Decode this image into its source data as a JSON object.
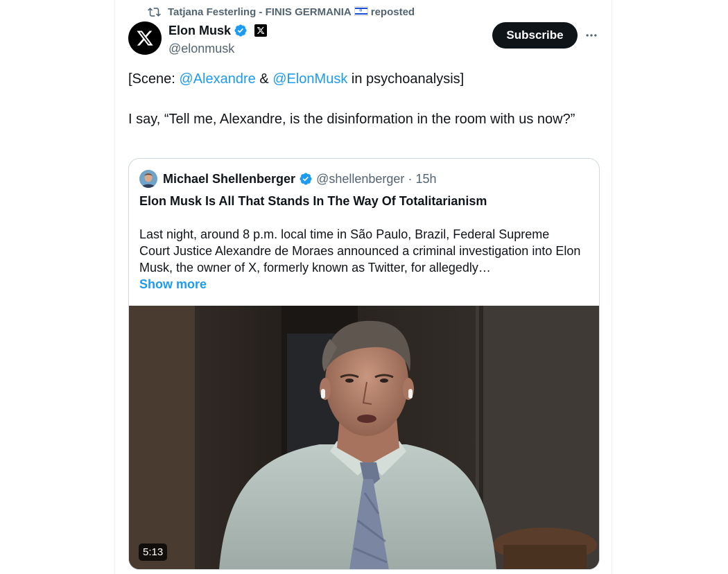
{
  "repost": {
    "name": "Tatjana Festerling - FINIS GERMANIA",
    "suffix": "reposted",
    "icon": "repost-icon",
    "flag_icon": "israel-flag-icon"
  },
  "author": {
    "name": "Elon Musk",
    "handle": "@elonmusk",
    "avatar_icon": "x-logo-icon",
    "verified_icon": "verified-badge-icon",
    "affiliate_icon": "x-affiliate-badge-icon"
  },
  "actions": {
    "subscribe_label": "Subscribe",
    "more_icon": "more-icon"
  },
  "tweet": {
    "line1_prefix": "[Scene: ",
    "mention1": "@Alexandre",
    "line1_mid": " & ",
    "mention2": "@ElonMusk",
    "line1_suffix": " in psychoanalysis]",
    "line2": "I say, “Tell me, Alexandre, is the disinformation in the room with us now?”"
  },
  "quote": {
    "author_name": "Michael Shellenberger",
    "handle": "@shellenberger",
    "separator": "·",
    "time": "15h",
    "title": "Elon Musk Is All That Stands In The Way Of Totalitarianism",
    "body": "Last night, around 8 p.m. local time in São Paulo, Brazil, Federal Supreme Court Justice Alexandre de Moraes announced a criminal investigation into Elon Musk, the owner of X, formerly known as Twitter, for allegedly…",
    "show_more": "Show more",
    "video_duration": "5:13"
  },
  "colors": {
    "link": "#1d9bf0",
    "verified": "#1d9bf0",
    "text": "#0f1419",
    "secondary": "#536471",
    "border": "#cfd9de",
    "button_bg": "#0f1419"
  }
}
